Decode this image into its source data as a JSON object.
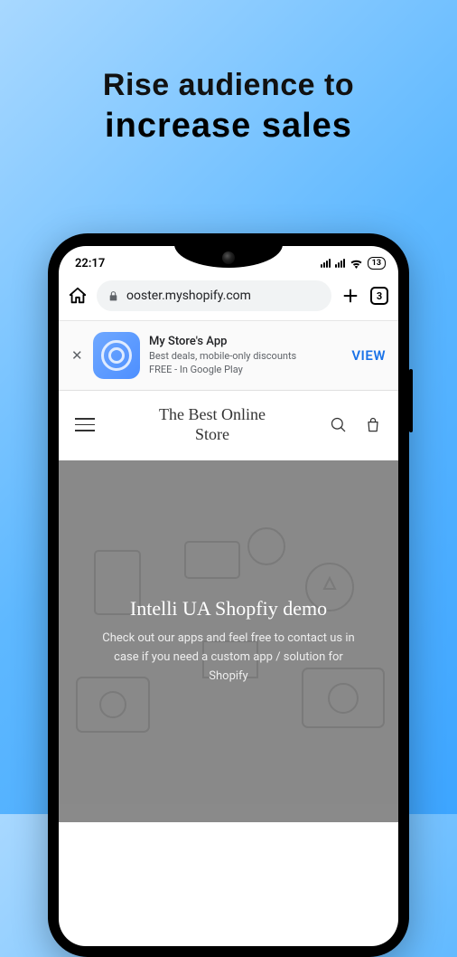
{
  "headline": {
    "line1": "Rise audience to",
    "line2": "increase sales"
  },
  "statusBar": {
    "time": "22:17",
    "battery": "13"
  },
  "browser": {
    "url": "ooster.myshopify.com",
    "tabCount": "3"
  },
  "installBanner": {
    "title": "My Store's App",
    "subtitle": "Best deals, mobile-only discounts",
    "meta": "FREE - In Google Play",
    "action": "VIEW"
  },
  "storeHeader": {
    "title_line1": "The Best Online",
    "title_line2": "Store"
  },
  "hero": {
    "title": "Intelli UA Shopfiy demo",
    "subtitle": "Check out our apps and feel free to contact us in case if you need a custom app / solution for Shopify"
  }
}
